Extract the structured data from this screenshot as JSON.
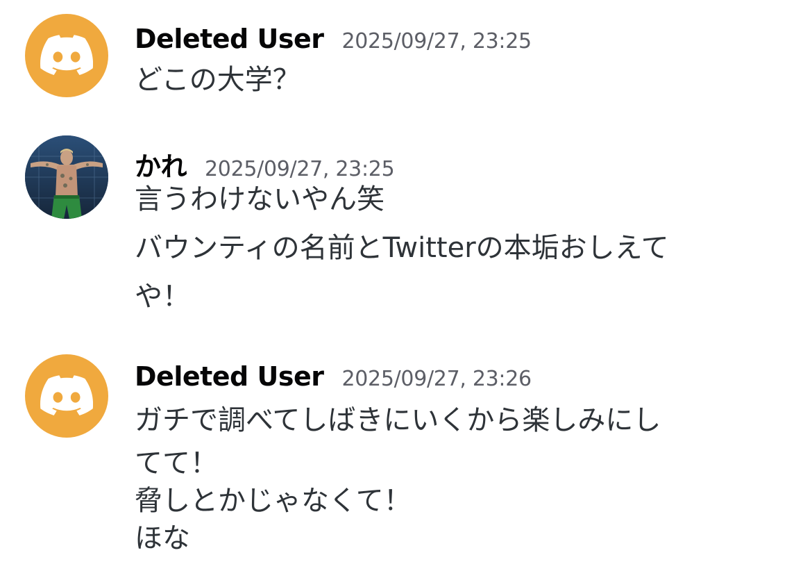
{
  "messages": [
    {
      "username": "Deleted User",
      "timestamp": "2025/09/27, 23:25",
      "avatar_icon": "discord-logo-icon",
      "avatar_color": "#f0a93e",
      "lines": [
        "どこの大学？"
      ]
    },
    {
      "username": "かれ",
      "timestamp": "2025/09/27, 23:25",
      "avatar_icon": "fighter-photo-avatar",
      "lines": [
        "言うわけないやん笑",
        "バウンティの名前とTwitterの本垢おしえて",
        "や！"
      ]
    },
    {
      "username": "Deleted User",
      "timestamp": "2025/09/27, 23:26",
      "avatar_icon": "discord-logo-icon",
      "avatar_color": "#f0a93e",
      "lines": [
        "ガチで調べてしばきにいくから楽しみにし",
        "てて！",
        "脅しとかじゃなくて！",
        "ほな"
      ]
    }
  ]
}
